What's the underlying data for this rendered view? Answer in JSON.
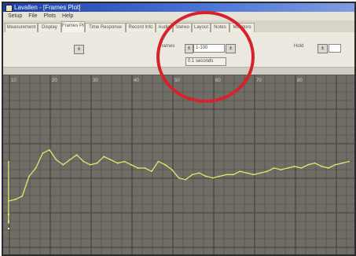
{
  "window": {
    "title": "Lavallen - [Frames Plot]"
  },
  "menu": {
    "items": [
      "Setup",
      "File",
      "Plots",
      "Help"
    ]
  },
  "tabs": [
    {
      "label": "Measurement",
      "active": false
    },
    {
      "label": "Display",
      "active": false
    },
    {
      "label": "Frames Plot",
      "active": true
    },
    {
      "label": "Time Response",
      "active": false
    },
    {
      "label": "Record Info",
      "active": false
    },
    {
      "label": "Audio",
      "active": false
    },
    {
      "label": "Stereo",
      "active": false
    },
    {
      "label": "Layout",
      "active": false
    },
    {
      "label": "Notes",
      "active": false
    },
    {
      "label": "Monitors",
      "active": false
    }
  ],
  "toolbar": {
    "frames_label": "Frames",
    "frames_value": "1-100",
    "right_label": "Hold",
    "position_value": "0.1 seconds",
    "step_symbol": "±"
  },
  "plot": {
    "background": "#6f6d66",
    "grid_color": "#4a4843",
    "trace_color": "#e2e86c",
    "x_tick_labels": [
      "10",
      "20",
      "30",
      "40",
      "50",
      "60",
      "70",
      "80"
    ]
  },
  "chart_data": {
    "type": "line",
    "series": [
      {
        "values": [
          30,
          31,
          33,
          45,
          50,
          59,
          61,
          55,
          52,
          55,
          58,
          54,
          52,
          53,
          57,
          55,
          53,
          54,
          52,
          50,
          50,
          48,
          54,
          52,
          49,
          44,
          43,
          46,
          47,
          45,
          44,
          45,
          46,
          46,
          48,
          47,
          46,
          47,
          48,
          50,
          49,
          50,
          51,
          50,
          52,
          53,
          51,
          50,
          52,
          53,
          54
        ]
      }
    ]
  }
}
